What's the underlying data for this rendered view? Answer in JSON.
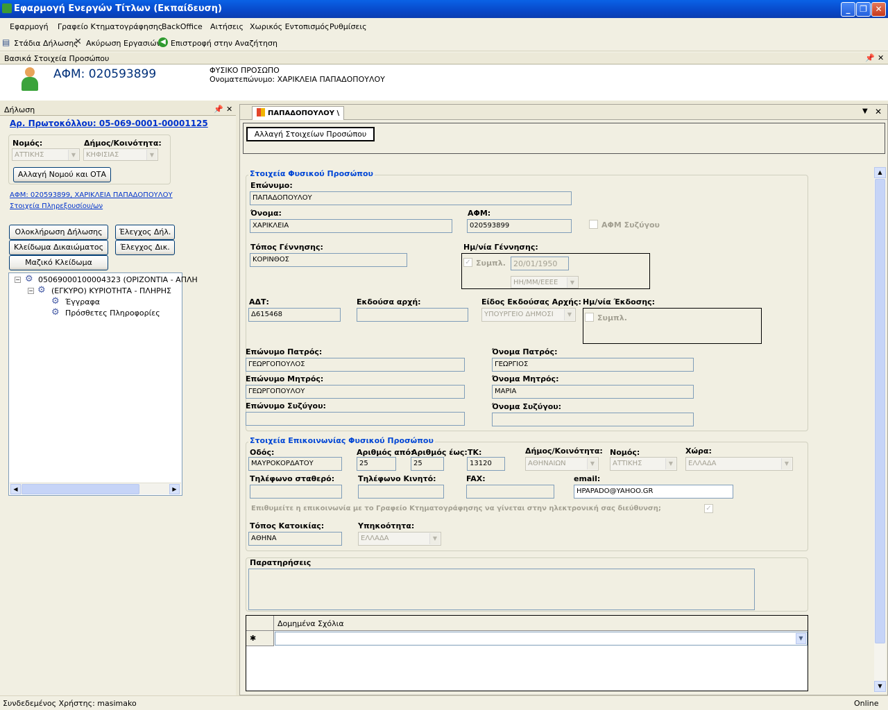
{
  "window": {
    "title": "Εφαρμογή Ενεργών Τίτλων (Εκπαίδευση)",
    "min": "_",
    "max": "❐",
    "close": "✕"
  },
  "menu": [
    "Εφαρμογή",
    "Γραφείο Κτηματογράφησης",
    "BackOffice",
    "Αιτήσεις",
    "Χωρικός Εντοπισμός",
    "Ρυθμίσεις"
  ],
  "toolbar": {
    "stages": "Στάδια Δήλωσης",
    "cancel": "Ακύρωση Εργασιών",
    "back": "Επιστροφή στην Αναζήτηση"
  },
  "person_panel": {
    "title": "Βασικά Στοιχεία Προσώπου",
    "afm": "ΑΦΜ: 020593899",
    "type": "ΦΥΣΙΚΟ ΠΡΟΣΩΠΟ",
    "fullname": "Ονοματεπώνυμο: ΧΑΡΙΚΛΕΙΑ ΠΑΠΑΔΟΠΟΥΛΟΥ"
  },
  "left": {
    "title": "Δήλωση",
    "protocol": "Αρ. Πρωτοκόλλου: 05-069-0001-00001125",
    "nomos_label": "Νομός:",
    "nomos": "ΑΤΤΙΚΗΣ",
    "dimos_label": "Δήμος/Κοινότητα:",
    "dimos": "ΚΗΦΙΣΙΑΣ",
    "change_ota": "Αλλαγή Νομού και ΟΤΑ",
    "afm_link": "ΑΦΜ: 020593899, ΧΑΡΙΚΛΕΙΑ ΠΑΠΑΔΟΠΟΥΛΟΥ",
    "proxy_link": "Στοιχεία Πληρεξουσίου/ων",
    "complete": "Ολοκλήρωση Δήλωσης",
    "check_decl": "Έλεγχος Δήλ.",
    "lock": "Κλείδωμα Δικαιώματος",
    "check_right": "Έλεγχος Δικ.",
    "mass_lock": "Μαζικό Κλείδωμα Δικαιωμ.",
    "tree": [
      "05069000100004323 (ΟΡΙΖΟΝΤΙΑ - ΑΠΛΗ",
      "(ΕΓΚΥΡΟ) ΚΥΡΙΟΤΗΤΑ - ΠΛΗΡΗΣ",
      "Έγγραφα",
      "Πρόσθετες Πληροφορίες"
    ]
  },
  "tab": {
    "label": "ΠΑΠΑΔΟΠΟΥΛΟΥ \\",
    "change_btn": "Αλλαγή Στοιχείων Προσώπου"
  },
  "form": {
    "g1": "Στοιχεία Φυσικού Προσώπου",
    "surname_l": "Επώνυμο:",
    "surname": "ΠΑΠΑΔΟΠΟΥΛΟΥ",
    "name_l": "Όνομα:",
    "name": "ΧΑΡΙΚΛΕΙΑ",
    "afm_l": "ΑΦΜ:",
    "afm": "020593899",
    "spouse_afm": "ΑΦΜ Συζύγου",
    "birthplace_l": "Τόπος Γέννησης:",
    "birthplace": "ΚΟΡΙΝΘΟΣ",
    "birthdate_l": "Ημ/νία Γέννησης:",
    "symp": "Συμπλ.",
    "birthdate": "20/01/1950",
    "datefmt": "ΗΗ/ΜΜ/ΕΕΕΕ",
    "adt_l": "ΑΔΤ:",
    "adt": "Δ615468",
    "auth_l": "Εκδούσα αρχή:",
    "authtype_l": "Είδος Εκδούσας Αρχής:",
    "authtype": "ΥΠΟΥΡΓΕΙΟ ΔΗΜΟΣΙ",
    "issue_l": "Ημ/νία Έκδοσης:",
    "symp2": "Συμπλ.",
    "fsur_l": "Επώνυμο Πατρός:",
    "fsur": "ΓΕΩΡΓΟΠΟΥΛΟΣ",
    "fname_l": "Όνομα Πατρός:",
    "fname": "ΓΕΩΡΓΙΟΣ",
    "msur_l": "Επώνυμο Μητρός:",
    "msur": "ΓΕΩΡΓΟΠΟΥΛΟΥ",
    "mname_l": "Όνομα Μητρός:",
    "mname": "ΜΑΡΙΑ",
    "ssur_l": "Επώνυμο Συζύγου:",
    "sname_l": "Όνομα Συζύγου:",
    "g2": "Στοιχεία Επικοινωνίας Φυσικού Προσώπου",
    "street_l": "Οδός:",
    "street": "ΜΑΥΡΟΚΟΡΔΑΤΟΥ",
    "from_l": "Αριθμός από:",
    "from": "25",
    "to_l": "Αριθμός έως:",
    "to": "25",
    "tk_l": "ΤΚ:",
    "tk": "13120",
    "dim_l": "Δήμος/Κοινότητα:",
    "dim": "ΑΘΗΝΑΙΩΝ",
    "nom_l": "Νομός:",
    "nom": "ΑΤΤΙΚΗΣ",
    "country_l": "Χώρα:",
    "country": "ΕΛΛΑΔΑ",
    "phone_l": "Τηλέφωνο σταθερό:",
    "mobile_l": "Τηλέφωνο Κινητό:",
    "fax_l": "FAX:",
    "email_l": "email:",
    "email": "HPAPADO@YAHOO.GR",
    "consent": "Επιθυμείτε η επικοινωνία με το Γραφείο Κτηματογράφησης να γίνεται στην ηλεκτρονική σας διεύθυνση;",
    "residence_l": "Τόπος Κατοικίας:",
    "residence": "ΑΘΗΝΑ",
    "citizen_l": "Υπηκοότητα:",
    "citizen": "ΕΛΛΑΔΑ",
    "notes_l": "Παρατηρήσεις",
    "grid_col": "Δομημένα Σχόλια",
    "grid_star": "✱"
  },
  "status": {
    "user": "Συνδεδεμένος Χρήστης: masimako",
    "online": "Online"
  }
}
